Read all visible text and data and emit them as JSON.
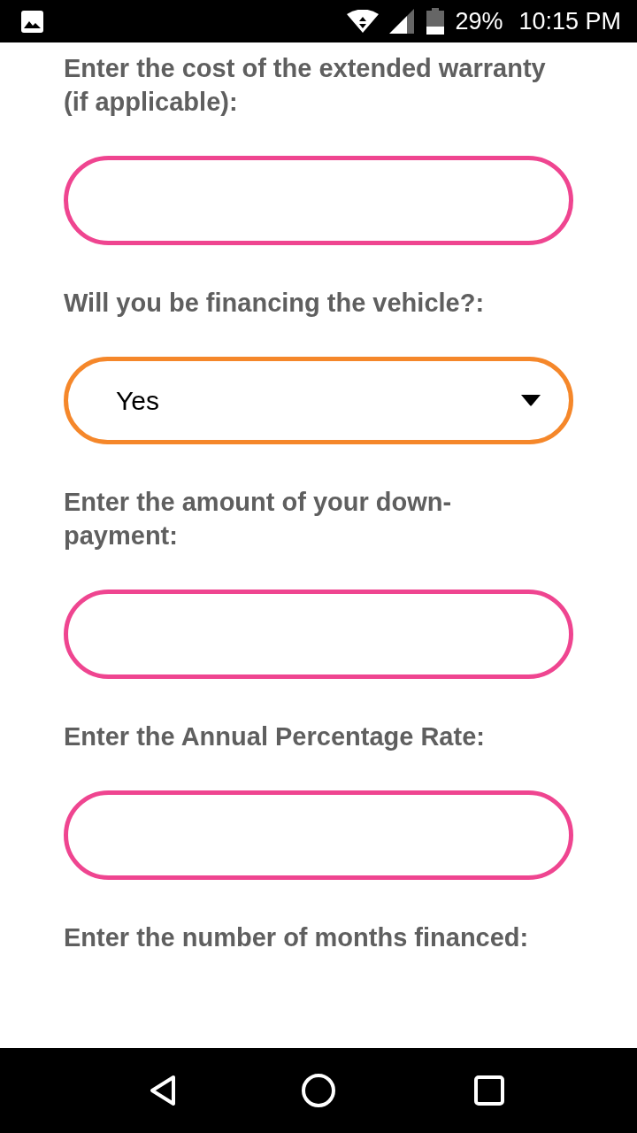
{
  "status_bar": {
    "battery": "29%",
    "time": "10:15 PM"
  },
  "form": {
    "fields": [
      {
        "kind": "text",
        "label": "Enter the cost of the extended warranty (if applicable):"
      },
      {
        "kind": "select",
        "label": "Will you be financing the vehicle?:",
        "value": "Yes"
      },
      {
        "kind": "text",
        "label": "Enter the amount of your down-payment:"
      },
      {
        "kind": "text",
        "label": "Enter the Annual Percentage Rate:"
      },
      {
        "kind": "label_only",
        "label": "Enter the number of months financed:"
      }
    ]
  }
}
